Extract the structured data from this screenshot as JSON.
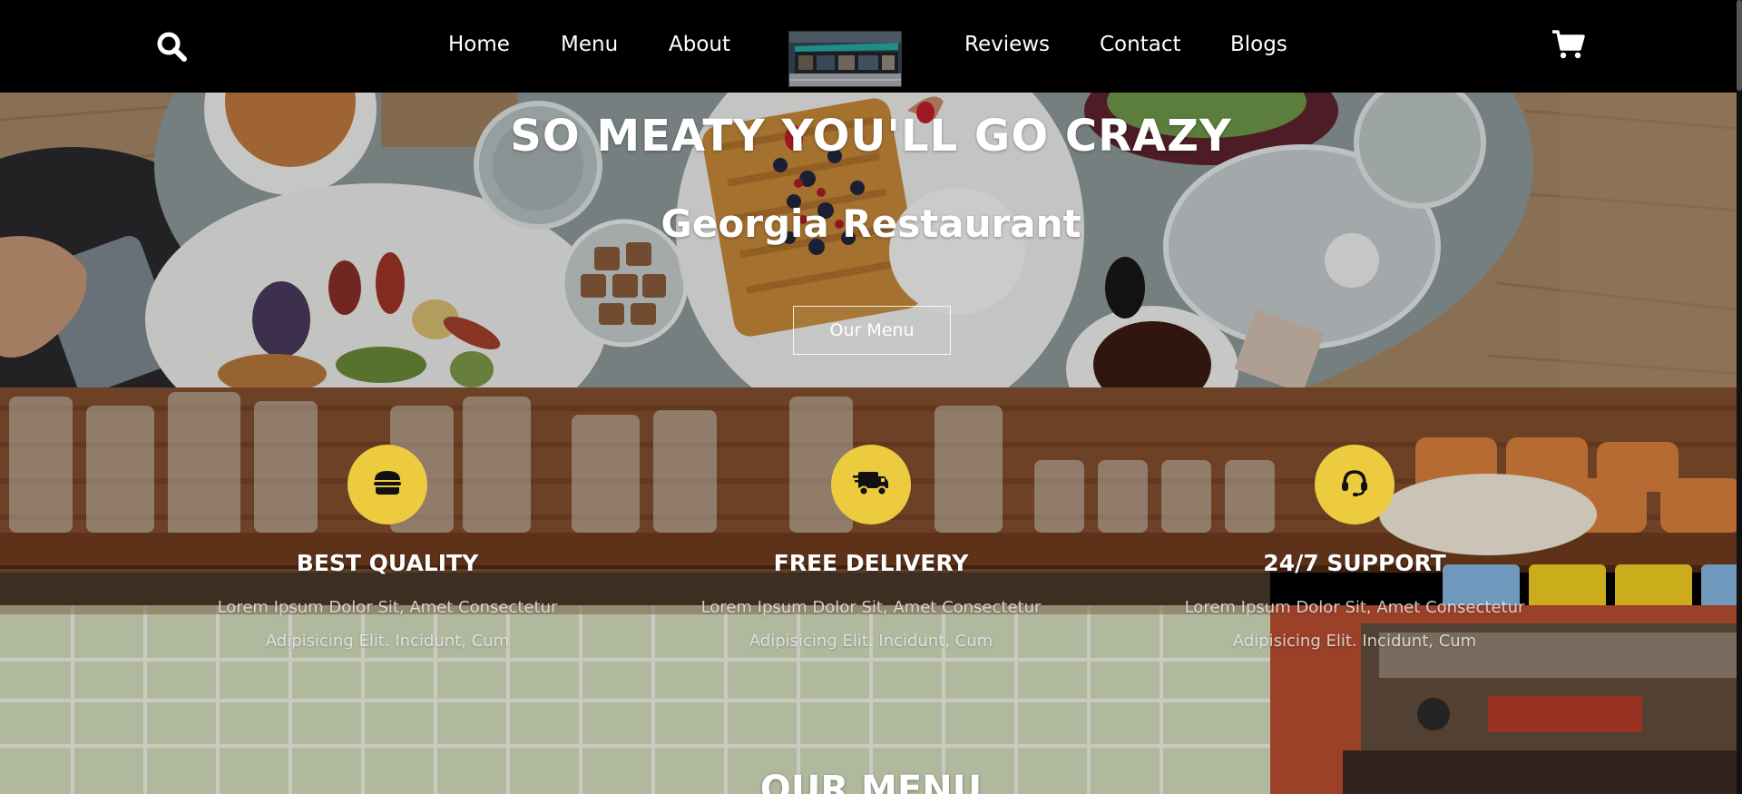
{
  "nav": {
    "search_icon": "search-icon",
    "links_left": [
      "Home",
      "Menu",
      "About"
    ],
    "links_right": [
      "Reviews",
      "Contact",
      "Blogs"
    ],
    "cart_icon": "shopping-cart-icon"
  },
  "hero": {
    "title": "SO MEATY YOU'LL GO CRAZY",
    "subtitle": "Georgia Restaurant",
    "button_label": "Our Menu"
  },
  "features": [
    {
      "icon": "burger-icon",
      "title": "BEST QUALITY",
      "line1": "Lorem Ipsum Dolor Sit, Amet Consectetur",
      "line2": "Adipisicing Elit. Incidunt, Cum"
    },
    {
      "icon": "delivery-truck-icon",
      "title": "FREE DELIVERY",
      "line1": "Lorem Ipsum Dolor Sit, Amet Consectetur",
      "line2": "Adipisicing Elit. Incidunt, Cum"
    },
    {
      "icon": "headset-icon",
      "title": "24/7 SUPPORT",
      "line1": "Lorem Ipsum Dolor Sit, Amet Consectetur",
      "line2": "Adipisicing Elit. Incidunt, Cum"
    }
  ],
  "section": {
    "heading": "OUR MENU"
  },
  "colors": {
    "accent": "#eccb3f",
    "navbar": "#000000"
  }
}
